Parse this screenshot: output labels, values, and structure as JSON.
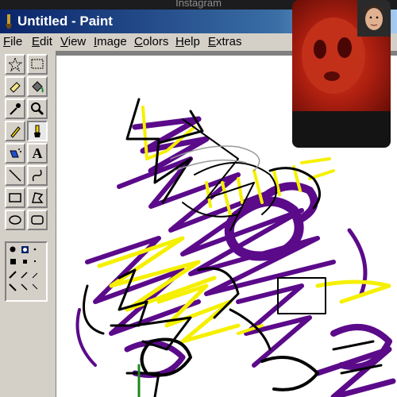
{
  "overlay": {
    "app_label": "Instagram"
  },
  "window": {
    "title": "Untitled - Paint"
  },
  "menu": [
    {
      "first": "F",
      "rest": "ile"
    },
    {
      "first": "E",
      "rest": "dit"
    },
    {
      "first": "V",
      "rest": "iew"
    },
    {
      "first": "I",
      "rest": "mage"
    },
    {
      "first": "C",
      "rest": "olors"
    },
    {
      "first": "H",
      "rest": "elp"
    },
    {
      "first": "E",
      "rest": "xtras"
    }
  ],
  "toolbox": {
    "text_tool_glyph": "A",
    "tools": [
      "free-form-select-icon",
      "select-icon",
      "eraser-icon",
      "fill-icon",
      "color-picker-icon",
      "magnifier-icon",
      "pencil-icon",
      "brush-icon",
      "airbrush-icon",
      "text-icon",
      "line-icon",
      "curve-icon",
      "rectangle-icon",
      "polygon-icon",
      "ellipse-icon",
      "rounded-rectangle-icon"
    ],
    "active_tool": "brush-icon"
  },
  "colors": {
    "purple": "#5b0a8a",
    "yellow": "#f5f000",
    "black": "#000000",
    "titlebar_start": "#0a246a"
  }
}
